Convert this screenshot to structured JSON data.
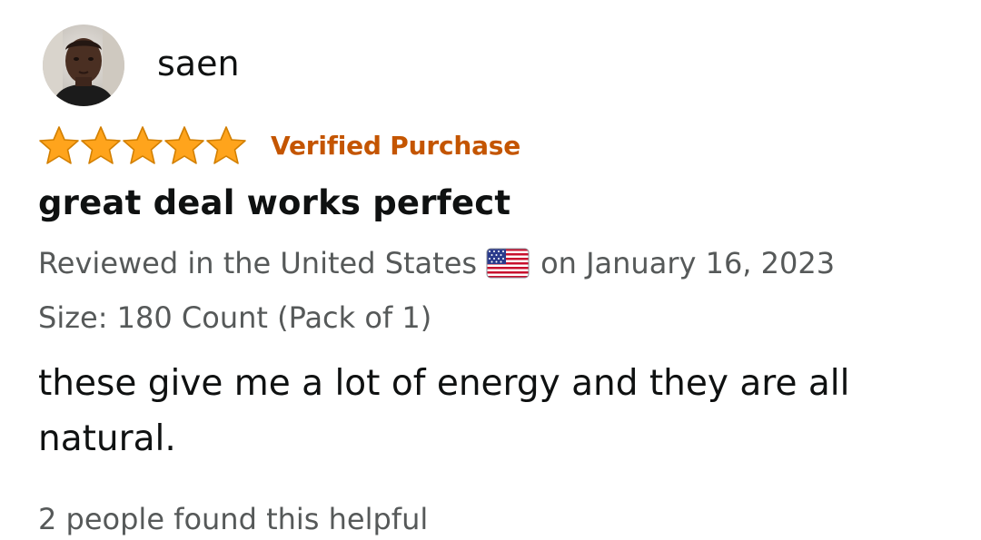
{
  "review": {
    "username": "saen",
    "rating": 5,
    "rating_max": 5,
    "verified_label": "Verified Purchase",
    "title": "great deal works perfect",
    "reviewed_in": "Reviewed in the United States",
    "flag_icon": "us-flag-icon",
    "date_text": "on January 16, 2023",
    "size_label": "Size: 180 Count (Pack of 1)",
    "body": "these give me a lot of energy and they are all natural.",
    "helpful_text": "2 people found this helpful"
  },
  "colors": {
    "star": "#ffa41c",
    "verified": "#c45500",
    "text_primary": "#0f1111",
    "text_secondary": "#565959"
  }
}
